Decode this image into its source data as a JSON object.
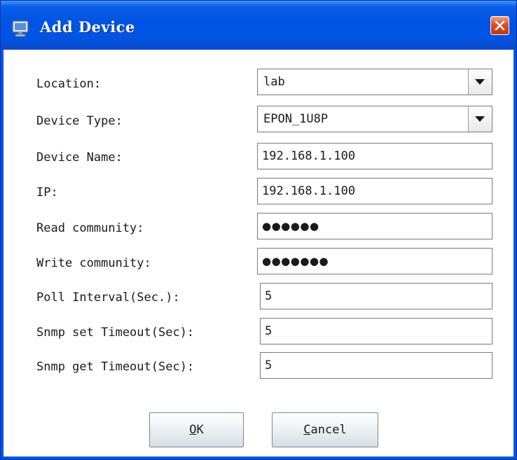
{
  "window": {
    "title": "Add Device",
    "close_icon": "close-icon",
    "app_icon": "computer-icon"
  },
  "form": {
    "location": {
      "label": "Location:",
      "value": "lab"
    },
    "device_type": {
      "label": "Device Type:",
      "value": "EPON_1U8P"
    },
    "device_name": {
      "label": "Device Name:",
      "value": "192.168.1.100"
    },
    "ip": {
      "label": "IP:",
      "value": "192.168.1.100"
    },
    "read_community": {
      "label": "Read community:",
      "value": "●●●●●●"
    },
    "write_community": {
      "label": "Write community:",
      "value": "●●●●●●●"
    },
    "poll_interval": {
      "label": "Poll Interval(Sec.):",
      "value": "5"
    },
    "snmp_set_timeout": {
      "label": "Snmp set Timeout(Sec):",
      "value": "5"
    },
    "snmp_get_timeout": {
      "label": "Snmp get Timeout(Sec):",
      "value": "5"
    }
  },
  "buttons": {
    "ok": {
      "mnemonic": "O",
      "rest": "K"
    },
    "cancel": {
      "mnemonic": "C",
      "rest": "ancel"
    }
  },
  "colors": {
    "titlebar": "#0054e3",
    "close_button": "#e04d23",
    "field_border": "#7a7a7a"
  }
}
